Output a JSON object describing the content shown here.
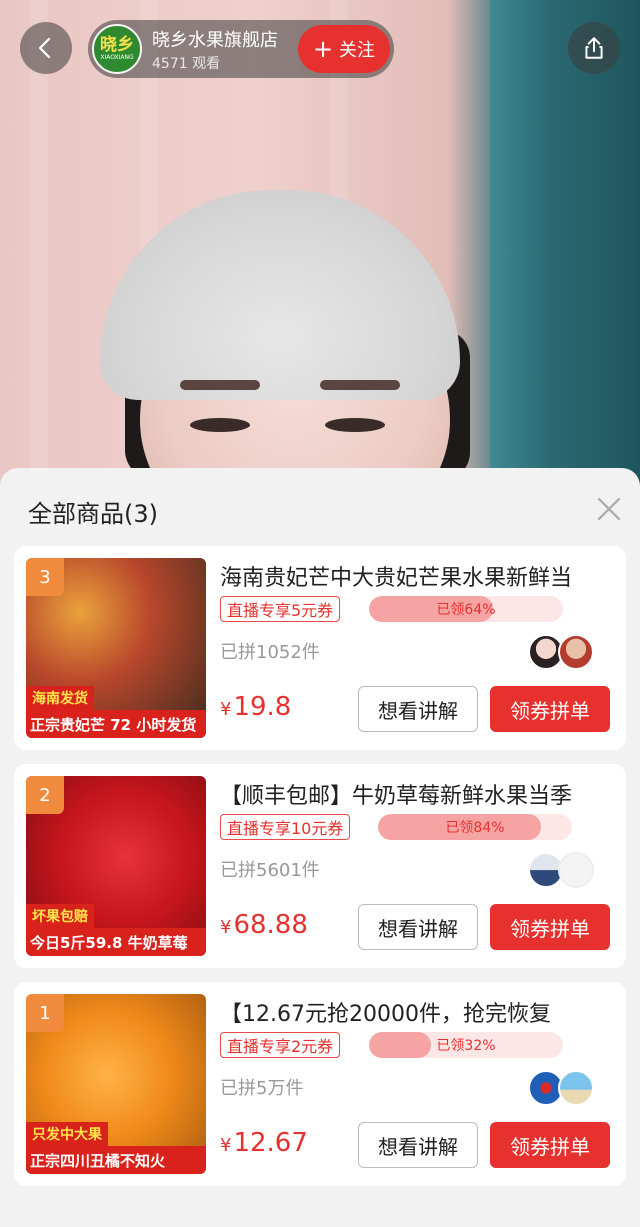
{
  "header": {
    "shop_name": "晓乡水果旗舰店",
    "viewers": "4571 观看",
    "follow_label": "关注",
    "logo_text": "晓乡",
    "logo_sub": "XIAOXIANG",
    "accent_color": "#e6312e"
  },
  "sheet": {
    "title": "全部商品(3)"
  },
  "products": [
    {
      "rank": "3",
      "title": "海南贵妃芒中大贵妃芒果水果新鲜当",
      "coupon": "直播专享5元券",
      "claimed": "已领64%",
      "claimed_pct": 64,
      "sold": "已拼1052件",
      "price": "19.8",
      "currency": "¥",
      "explain_label": "想看讲解",
      "buy_label": "领券拼单",
      "thumb_tag": "海南发货",
      "thumb_banner": "正宗贵妃芒 72 小时发货",
      "thumb_color": "#b8472c"
    },
    {
      "rank": "2",
      "title": "【顺丰包邮】牛奶草莓新鲜水果当季",
      "coupon": "直播专享10元券",
      "claimed": "已领84%",
      "claimed_pct": 84,
      "sold": "已拼5601件",
      "price": "68.88",
      "currency": "¥",
      "explain_label": "想看讲解",
      "buy_label": "领券拼单",
      "thumb_tag": "坏果包赔",
      "thumb_banner": "今日5斤59.8 牛奶草莓",
      "thumb_color": "#c8161d"
    },
    {
      "rank": "1",
      "title": "【12.67元抢20000件，抢完恢复",
      "coupon": "直播专享2元券",
      "claimed": "已领32%",
      "claimed_pct": 32,
      "sold": "已拼5万件",
      "price": "12.67",
      "currency": "¥",
      "explain_label": "想看讲解",
      "buy_label": "领券拼单",
      "thumb_tag": "只发中大果",
      "thumb_banner": "正宗四川丑橘不知火",
      "thumb_color": "#f08a1a"
    }
  ]
}
